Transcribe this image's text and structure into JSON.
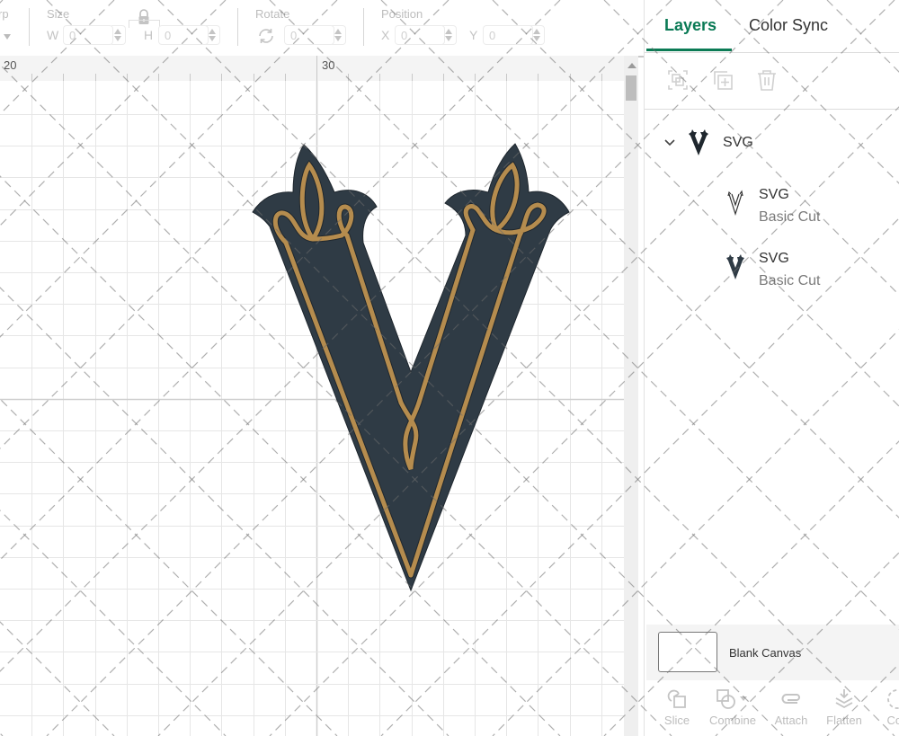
{
  "toolbar": {
    "partial_left_label": "rp",
    "size_label": "Size",
    "width_axis": "W",
    "width_value": "0",
    "height_axis": "H",
    "height_value": "0",
    "rotate_label": "Rotate",
    "rotate_value": "0",
    "position_label": "Position",
    "x_axis": "X",
    "x_value": "0",
    "y_axis": "Y",
    "y_value": "0"
  },
  "ruler": {
    "labels": [
      "20",
      "30"
    ]
  },
  "canvas": {
    "design_colors": {
      "base_fill": "#2f3b45",
      "accent_line": "#b58c4e"
    }
  },
  "panel": {
    "tabs": [
      {
        "label": "Layers",
        "active": true
      },
      {
        "label": "Color Sync",
        "active": false
      }
    ],
    "tools": [
      "group-icon",
      "duplicate-icon",
      "delete-icon"
    ],
    "layers": {
      "group": {
        "name": "SVG",
        "expanded": true
      },
      "children": [
        {
          "name": "SVG",
          "operation": "Basic Cut"
        },
        {
          "name": "SVG",
          "operation": "Basic Cut"
        }
      ]
    },
    "blank_canvas_label": "Blank Canvas",
    "actions": [
      {
        "label": "Slice",
        "icon": "slice-icon"
      },
      {
        "label": "Combine",
        "icon": "combine-icon"
      },
      {
        "label": "Attach",
        "icon": "attach-icon"
      },
      {
        "label": "Flatten",
        "icon": "flatten-icon"
      },
      {
        "label": "Cor",
        "icon": "contour-icon"
      }
    ],
    "accent_color": "#0b7b55"
  }
}
